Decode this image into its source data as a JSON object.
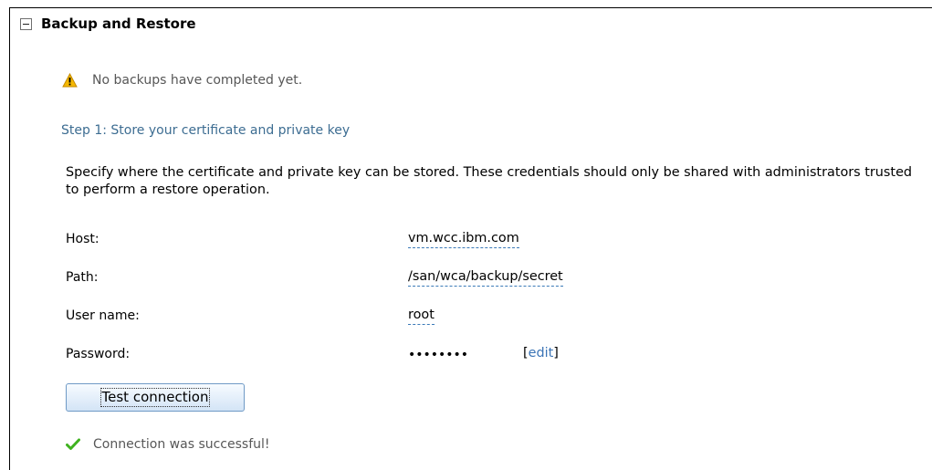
{
  "section": {
    "title": "Backup and Restore",
    "collapse_icon": "minus-box-icon"
  },
  "warning": {
    "icon": "warning-icon",
    "icon_color": "#f5b800",
    "text": "No backups have completed yet."
  },
  "step": {
    "title": "Step 1: Store your certificate and private key",
    "description": "Specify where the certificate and private key can be stored. These credentials should only be shared with administrators trusted to perform a restore operation."
  },
  "fields": {
    "host": {
      "label": "Host:",
      "value": "vm.wcc.ibm.com"
    },
    "path": {
      "label": "Path:",
      "value": "/san/wca/backup/secret"
    },
    "username": {
      "label": "User name:",
      "value": "root"
    },
    "password": {
      "label": "Password:",
      "masked_value": "••••••••",
      "edit_open": "[",
      "edit_label": "edit",
      "edit_close": "]"
    }
  },
  "test_button": {
    "label": "Test connection"
  },
  "status": {
    "icon": "checkmark-icon",
    "icon_color": "#3fb21f",
    "text": "Connection was successful!"
  },
  "colors": {
    "step_title": "#3d6d92",
    "link": "#3b74b6",
    "muted_text": "#575757"
  }
}
